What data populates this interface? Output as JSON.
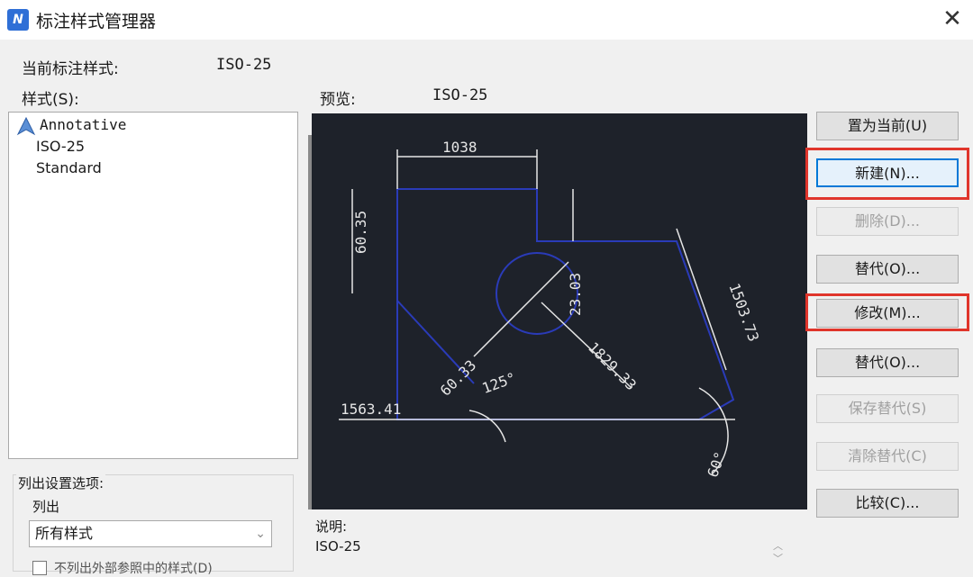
{
  "window": {
    "title": "标注样式管理器",
    "close_glyph": "✕"
  },
  "current_style": {
    "label": "当前标注样式:",
    "value": "ISO-25"
  },
  "styles": {
    "label": "样式(S):",
    "items": [
      "Annotative",
      "ISO-25",
      "Standard"
    ]
  },
  "preview": {
    "label": "预览:",
    "value": "ISO-25",
    "dims": [
      "1038",
      "60.35",
      "60.33",
      "1829.33",
      "1563.41",
      "1503.73",
      "23.03",
      "125°",
      "60°"
    ]
  },
  "buttons": {
    "set_current": "置为当前(U)",
    "new": "新建(N)...",
    "delete": "删除(D)...",
    "modify": "修改(M)...",
    "override": "替代(O)...",
    "compare": "比较(C)...",
    "save": "保存替代(S)",
    "clear": "清除替代(C)"
  },
  "list_group": {
    "title": "列出设置选项:",
    "list_label": "列出",
    "list_value": "所有样式",
    "checkbox_label": "不列出外部参照中的样式(D)"
  },
  "description": {
    "label": "说明:",
    "value": "ISO-25"
  },
  "colors": {
    "accent": "#0078d7",
    "highlight_red": "#e0352b",
    "preview_bg": "#1e222a",
    "preview_line": "#1c2a9a"
  }
}
